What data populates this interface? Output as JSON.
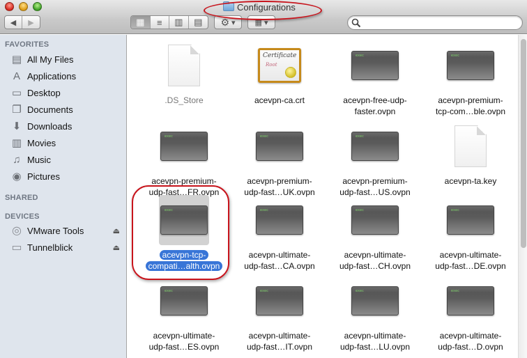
{
  "window": {
    "title": "Configurations"
  },
  "toolbar": {
    "back_label": "◀",
    "forward_label": "▶",
    "view_buttons": [
      {
        "name": "icon-view",
        "glyph": "▦",
        "active": true
      },
      {
        "name": "list-view",
        "glyph": "≡",
        "active": false
      },
      {
        "name": "column-view",
        "glyph": "▥",
        "active": false
      },
      {
        "name": "coverflow-view",
        "glyph": "▤",
        "active": false
      }
    ],
    "action_glyph": "⚙",
    "arrange_glyph": "▦",
    "dropdown_glyph": "▾",
    "search": {
      "value": "",
      "placeholder": ""
    }
  },
  "sidebar": {
    "favorites_heading": "FAVORITES",
    "favorites": [
      {
        "label": "All My Files",
        "icon": "all-my-files-icon",
        "glyph": "▤"
      },
      {
        "label": "Applications",
        "icon": "applications-icon",
        "glyph": "A"
      },
      {
        "label": "Desktop",
        "icon": "desktop-icon",
        "glyph": "▭"
      },
      {
        "label": "Documents",
        "icon": "documents-icon",
        "glyph": "❐"
      },
      {
        "label": "Downloads",
        "icon": "downloads-icon",
        "glyph": "⬇"
      },
      {
        "label": "Movies",
        "icon": "movies-icon",
        "glyph": "▥"
      },
      {
        "label": "Music",
        "icon": "music-icon",
        "glyph": "♫"
      },
      {
        "label": "Pictures",
        "icon": "pictures-icon",
        "glyph": "◉"
      }
    ],
    "shared_heading": "SHARED",
    "devices_heading": "DEVICES",
    "devices": [
      {
        "label": "VMware Tools",
        "icon": "disc-icon",
        "glyph": "◎",
        "eject": "⏏"
      },
      {
        "label": "Tunnelblick",
        "icon": "drive-icon",
        "glyph": "▭",
        "eject": "⏏"
      }
    ]
  },
  "files": [
    {
      "line1": ".DS_Store",
      "line2": "",
      "type": "document",
      "hidden": true,
      "selected": false
    },
    {
      "line1": "acevpn-ca.crt",
      "line2": "",
      "type": "certificate",
      "hidden": false,
      "selected": false
    },
    {
      "line1": "acevpn-free-udp-",
      "line2": "faster.ovpn",
      "type": "exec",
      "hidden": false,
      "selected": false
    },
    {
      "line1": "acevpn-premium-",
      "line2": "tcp-com…ble.ovpn",
      "type": "exec",
      "hidden": false,
      "selected": false
    },
    {
      "line1": "acevpn-premium-",
      "line2": "udp-fast…FR.ovpn",
      "type": "exec",
      "hidden": false,
      "selected": false
    },
    {
      "line1": "acevpn-premium-",
      "line2": "udp-fast…UK.ovpn",
      "type": "exec",
      "hidden": false,
      "selected": false
    },
    {
      "line1": "acevpn-premium-",
      "line2": "udp-fast…US.ovpn",
      "type": "exec",
      "hidden": false,
      "selected": false
    },
    {
      "line1": "acevpn-ta.key",
      "line2": "",
      "type": "document",
      "hidden": false,
      "selected": false
    },
    {
      "line1": "acevpn-tcp-",
      "line2": "compati…alth.ovpn",
      "type": "exec",
      "hidden": false,
      "selected": true
    },
    {
      "line1": "acevpn-ultimate-",
      "line2": "udp-fast…CA.ovpn",
      "type": "exec",
      "hidden": false,
      "selected": false
    },
    {
      "line1": "acevpn-ultimate-",
      "line2": "udp-fast…CH.ovpn",
      "type": "exec",
      "hidden": false,
      "selected": false
    },
    {
      "line1": "acevpn-ultimate-",
      "line2": "udp-fast…DE.ovpn",
      "type": "exec",
      "hidden": false,
      "selected": false
    },
    {
      "line1": "acevpn-ultimate-",
      "line2": "udp-fast…ES.ovpn",
      "type": "exec",
      "hidden": false,
      "selected": false
    },
    {
      "line1": "acevpn-ultimate-",
      "line2": "udp-fast…IT.ovpn",
      "type": "exec",
      "hidden": false,
      "selected": false
    },
    {
      "line1": "acevpn-ultimate-",
      "line2": "udp-fast…LU.ovpn",
      "type": "exec",
      "hidden": false,
      "selected": false
    },
    {
      "line1": "acevpn-ultimate-",
      "line2": "udp-fast…D.ovpn",
      "type": "exec",
      "hidden": false,
      "selected": false
    }
  ],
  "exec_badge": "exec",
  "certificate_text": {
    "title": "Certificate",
    "subtitle": "Root"
  },
  "colors": {
    "selection": "#3875d7",
    "annotation": "#c8141c",
    "sidebar_bg": "#dfe5ed"
  }
}
